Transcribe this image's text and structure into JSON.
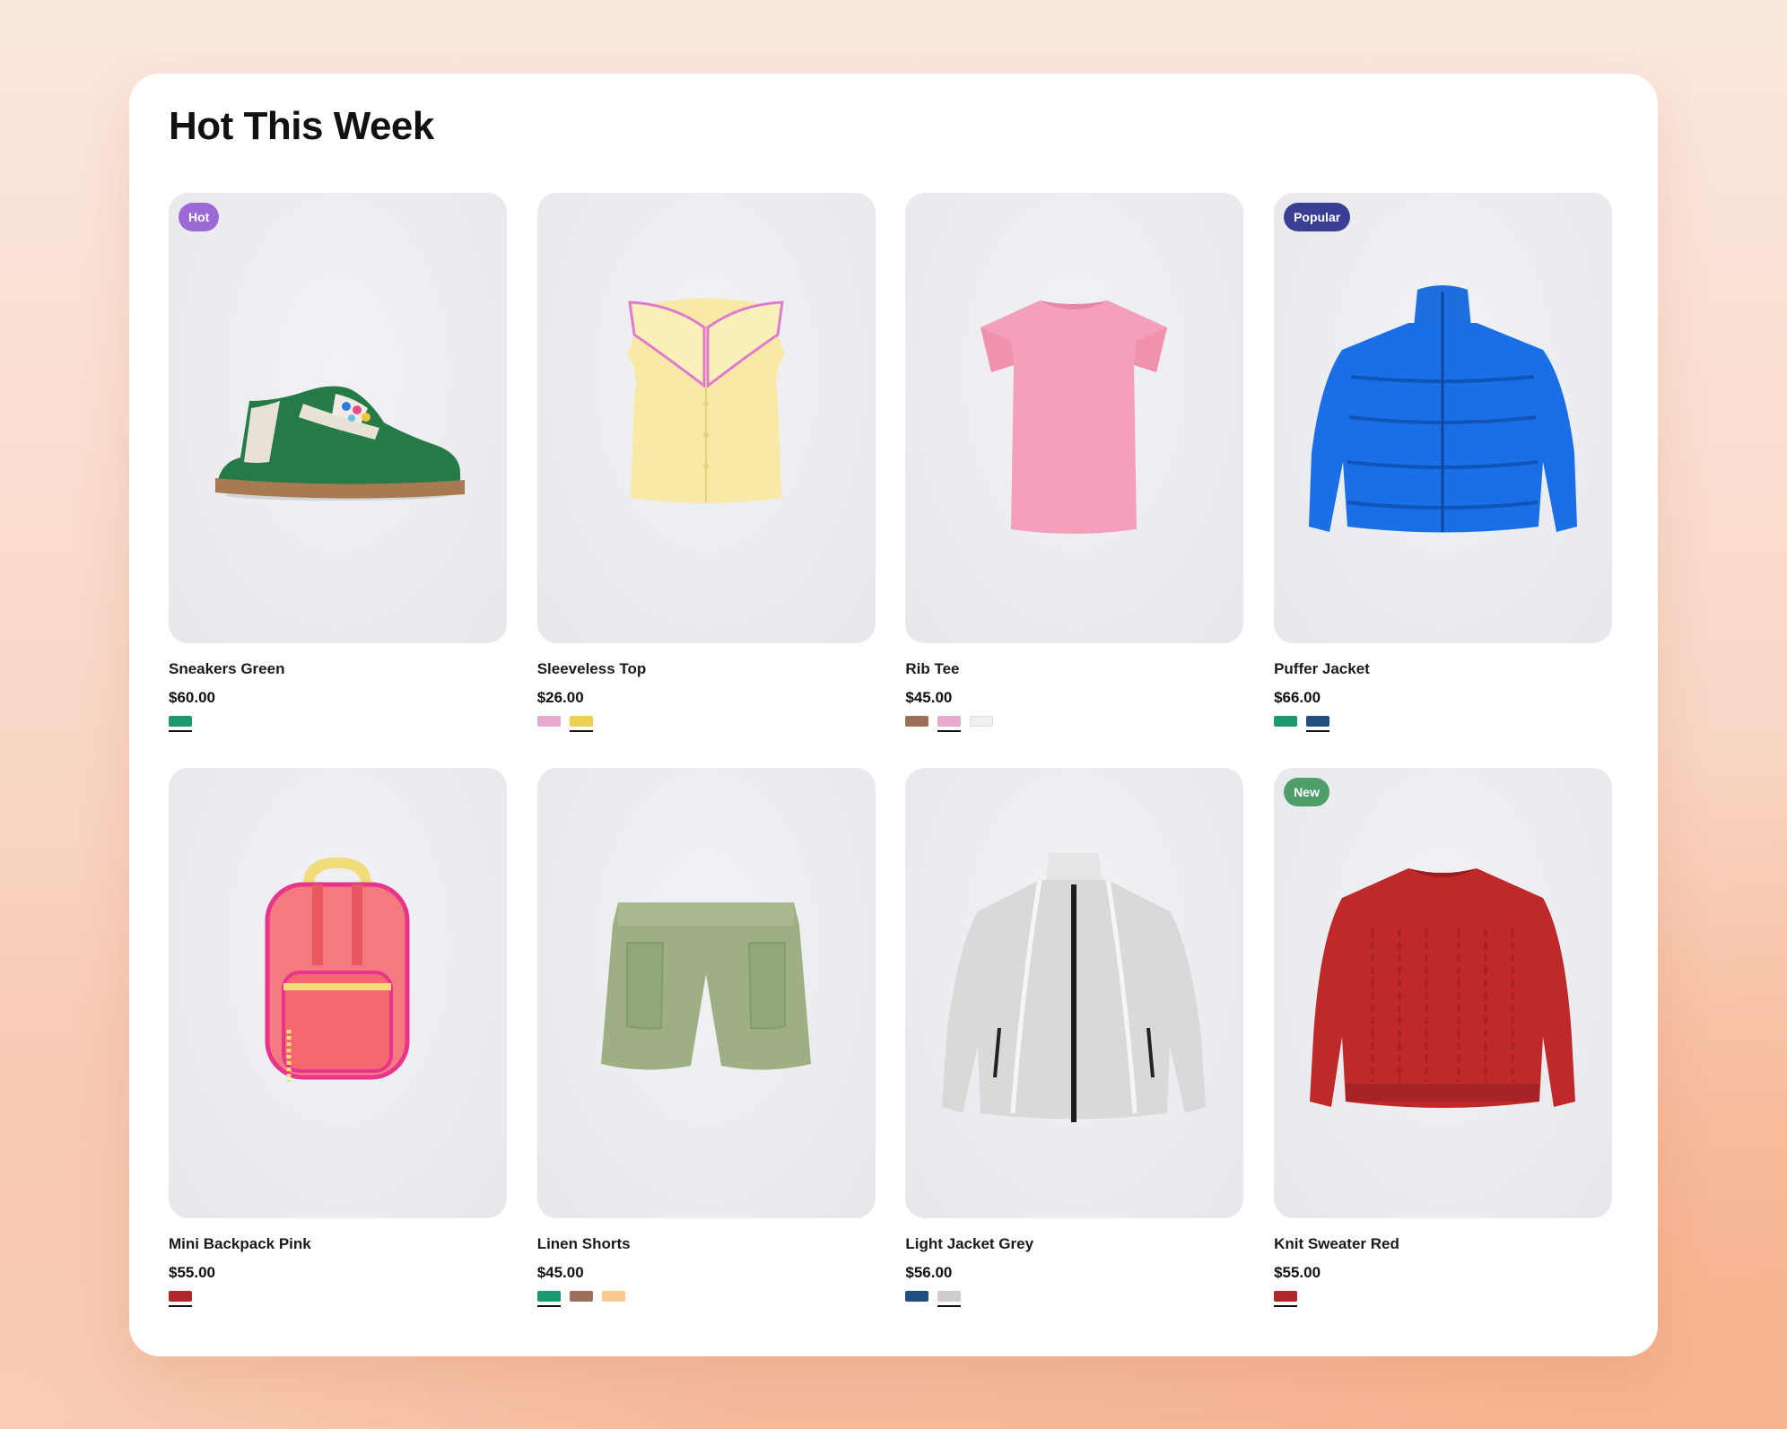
{
  "section": {
    "title": "Hot This Week"
  },
  "products": [
    {
      "name": "Sneakers Green",
      "price": "$60.00",
      "image_icon": "sneaker",
      "badge": {
        "label": "Hot",
        "color": "#9b6ad6"
      },
      "swatches": [
        {
          "color": "#1a9a6e",
          "selected": true
        }
      ]
    },
    {
      "name": "Sleeveless Top",
      "price": "$26.00",
      "image_icon": "sleeveless-top",
      "badge": null,
      "swatches": [
        {
          "color": "#e8a9cc",
          "selected": false
        },
        {
          "color": "#ecd052",
          "selected": true
        }
      ]
    },
    {
      "name": "Rib Tee",
      "price": "$45.00",
      "image_icon": "t-shirt",
      "badge": null,
      "swatches": [
        {
          "color": "#9b6f58",
          "selected": false
        },
        {
          "color": "#e8a9cc",
          "selected": true
        },
        {
          "color": "#f0f0f0",
          "selected": false
        }
      ]
    },
    {
      "name": "Puffer Jacket",
      "price": "$66.00",
      "image_icon": "puffer-jacket",
      "badge": {
        "label": "Popular",
        "color": "#3b3f94"
      },
      "swatches": [
        {
          "color": "#1a9a6e",
          "selected": false
        },
        {
          "color": "#1f4f7f",
          "selected": true
        }
      ]
    },
    {
      "name": "Mini Backpack Pink",
      "price": "$55.00",
      "image_icon": "backpack",
      "badge": null,
      "swatches": [
        {
          "color": "#b3262c",
          "selected": true
        }
      ]
    },
    {
      "name": "Linen Shorts",
      "price": "$45.00",
      "image_icon": "shorts",
      "badge": null,
      "swatches": [
        {
          "color": "#1a9a6e",
          "selected": true
        },
        {
          "color": "#9b6f58",
          "selected": false
        },
        {
          "color": "#fbc88e",
          "selected": false
        }
      ]
    },
    {
      "name": "Light Jacket Grey",
      "price": "$56.00",
      "image_icon": "light-jacket",
      "badge": null,
      "swatches": [
        {
          "color": "#1f4f7f",
          "selected": false
        },
        {
          "color": "#cdcdcd",
          "selected": true
        }
      ]
    },
    {
      "name": "Knit Sweater Red",
      "price": "$55.00",
      "image_icon": "sweater",
      "badge": {
        "label": "New",
        "color": "#4f9e6a"
      },
      "swatches": [
        {
          "color": "#b3262c",
          "selected": true
        }
      ]
    }
  ]
}
